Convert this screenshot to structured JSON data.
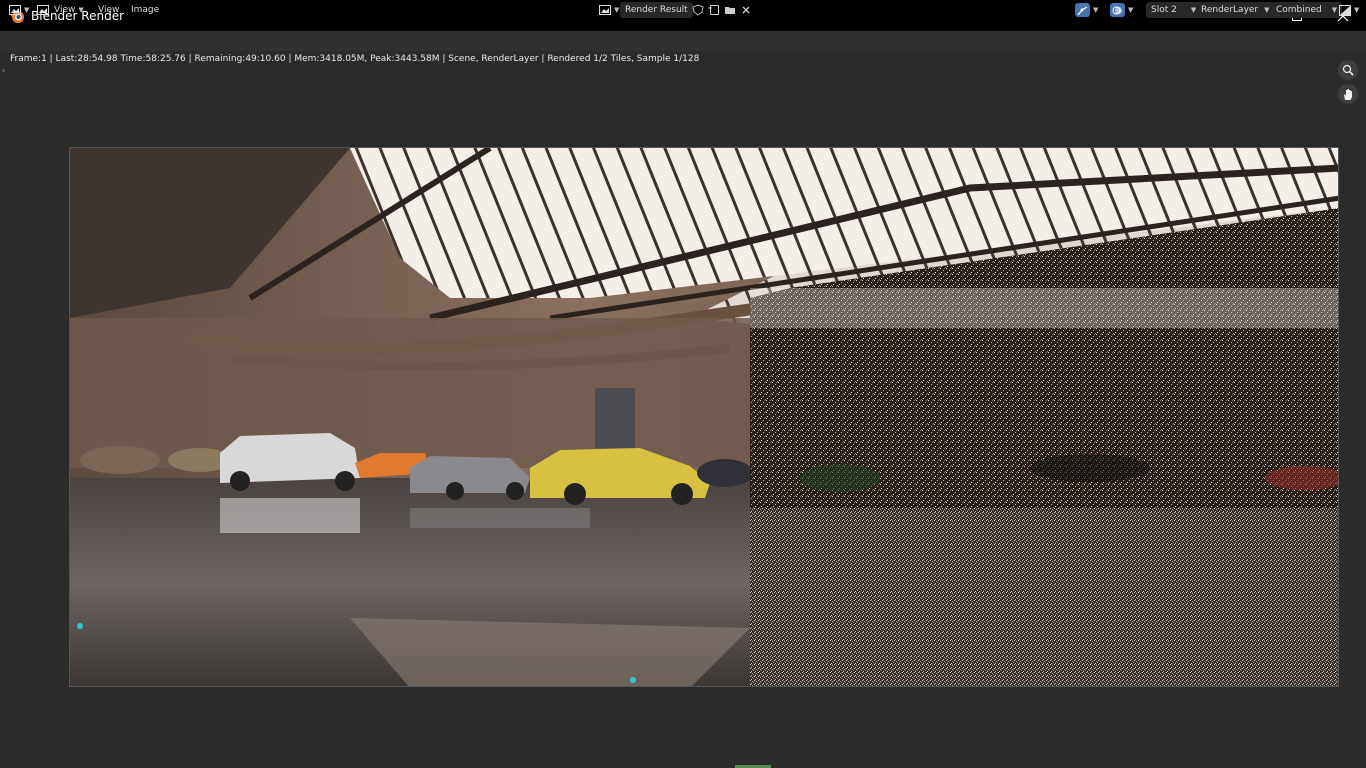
{
  "window": {
    "title": "Blender Render"
  },
  "header": {
    "view_menu_1": "View",
    "view_menu_2": "View",
    "image_menu": "Image",
    "image_name": "Render Result",
    "slot": "Slot 2",
    "layer": "RenderLayer",
    "pass": "Combined"
  },
  "status": {
    "text": "Frame:1 | Last:28:54.98 Time:58:25.76 | Remaining:49:10.60 | Mem:3418.05M, Peak:3443.58M | Scene, RenderLayer | Rendered 1/2 Tiles, Sample 1/128"
  },
  "icons": {
    "editor_type": "image-editor-icon",
    "mode": "view-mode-icon",
    "browse": "image-browse-icon",
    "fake_user": "shield-icon",
    "new_image": "new-image-icon",
    "open_image": "folder-icon",
    "unlink": "close-icon",
    "gizmo": "gizmo-icon",
    "overlay": "overlay-icon",
    "display_channels": "display-channels-icon",
    "zoom": "zoom-icon",
    "pan": "hand-icon"
  },
  "colors": {
    "titlebar": "#000000",
    "header": "#303030",
    "background": "#2b2b2b",
    "accent": "#4772b3"
  }
}
